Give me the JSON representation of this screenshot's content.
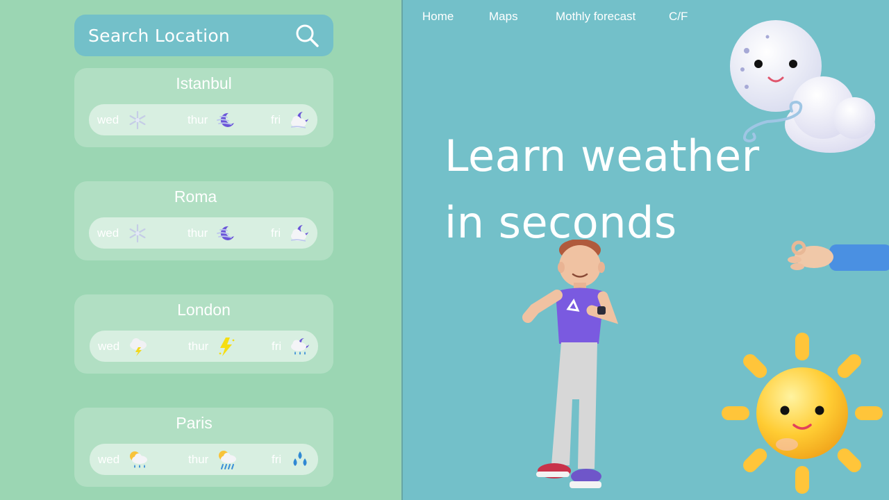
{
  "search": {
    "placeholder": "Search Location"
  },
  "nav": [
    {
      "label": "Home"
    },
    {
      "label": "Maps"
    },
    {
      "label": "Mothly forecast"
    },
    {
      "label": "C/F"
    }
  ],
  "hero": {
    "line1": "Learn weather",
    "line2": "in seconds"
  },
  "cities": [
    {
      "name": "Istanbul",
      "days": [
        {
          "label": "wed",
          "icon": "snowflake-icon"
        },
        {
          "label": "thur",
          "icon": "moon-wind-icon"
        },
        {
          "label": "fri",
          "icon": "moon-cloud-wind-icon"
        }
      ]
    },
    {
      "name": "Roma",
      "days": [
        {
          "label": "wed",
          "icon": "snowflake-icon"
        },
        {
          "label": "thur",
          "icon": "moon-wind-icon"
        },
        {
          "label": "fri",
          "icon": "moon-cloud-wind-icon"
        }
      ]
    },
    {
      "name": "London",
      "days": [
        {
          "label": "wed",
          "icon": "thunder-cloud-icon"
        },
        {
          "label": "thur",
          "icon": "lightning-icon"
        },
        {
          "label": "fri",
          "icon": "moon-rain-cloud-icon"
        }
      ]
    },
    {
      "name": "Paris",
      "days": [
        {
          "label": "wed",
          "icon": "sun-rain-cloud-icon"
        },
        {
          "label": "thur",
          "icon": "sun-storm-cloud-icon"
        },
        {
          "label": "fri",
          "icon": "raindrops-icon"
        }
      ]
    }
  ],
  "colors": {
    "left_panel": "#9bd6b3",
    "right_panel": "#73c0c9",
    "search_box": "#73c0c9",
    "text": "#ffffff"
  }
}
